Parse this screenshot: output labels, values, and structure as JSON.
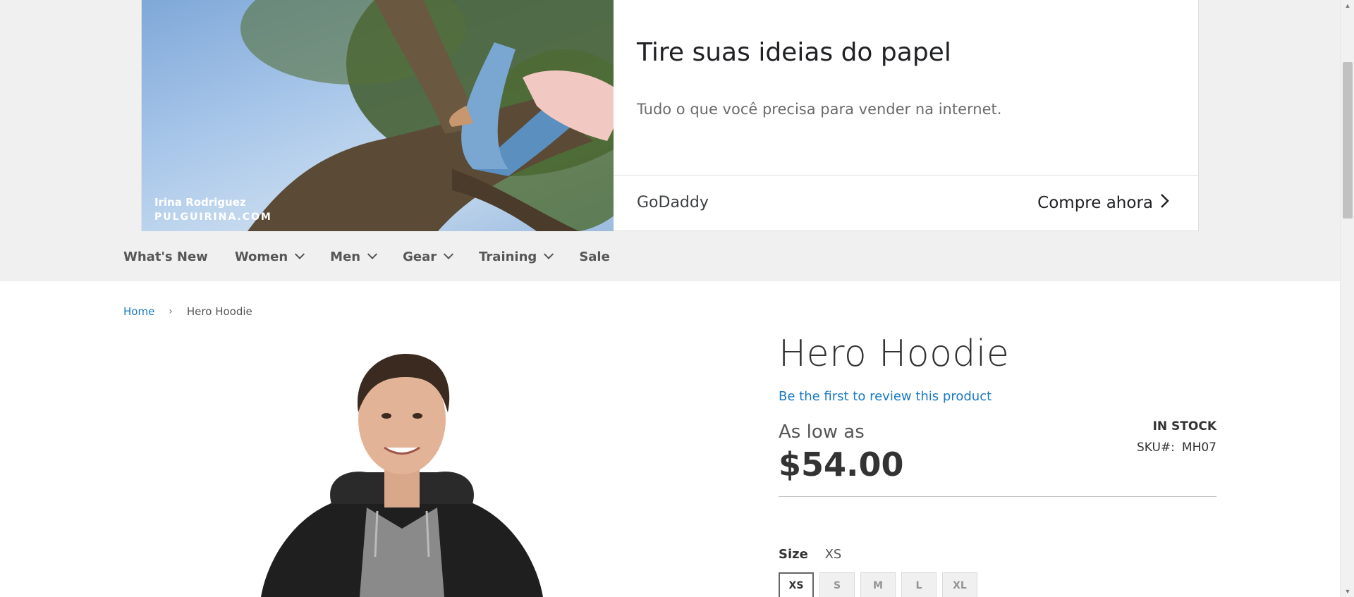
{
  "ad": {
    "credit_name": "Irina Rodriguez",
    "credit_site": "PULGUIRINA.COM",
    "title": "Tire suas ideias do papel",
    "subtitle": "Tudo o que você precisa para vender na internet.",
    "brand": "GoDaddy",
    "cta": "Compre ahora",
    "cta_icon": "chevron-right-icon"
  },
  "nav": {
    "items": [
      {
        "label": "What's New",
        "has_dropdown": false
      },
      {
        "label": "Women",
        "has_dropdown": true
      },
      {
        "label": "Men",
        "has_dropdown": true
      },
      {
        "label": "Gear",
        "has_dropdown": true
      },
      {
        "label": "Training",
        "has_dropdown": true
      },
      {
        "label": "Sale",
        "has_dropdown": false
      }
    ]
  },
  "breadcrumb": {
    "home": "Home",
    "separator": "›",
    "current": "Hero Hoodie"
  },
  "product": {
    "title": "Hero Hoodie",
    "review_link": "Be the first to review this product",
    "price_prefix": "As low as",
    "price": "$54.00",
    "stock": "IN STOCK",
    "sku_label": "SKU#:",
    "sku": "MH07",
    "size_label": "Size",
    "size_selected": "XS",
    "sizes": [
      "XS",
      "S",
      "M",
      "L",
      "XL"
    ]
  },
  "colors": {
    "link": "#1979c3",
    "band": "#f0f0f0",
    "text": "#333333"
  }
}
